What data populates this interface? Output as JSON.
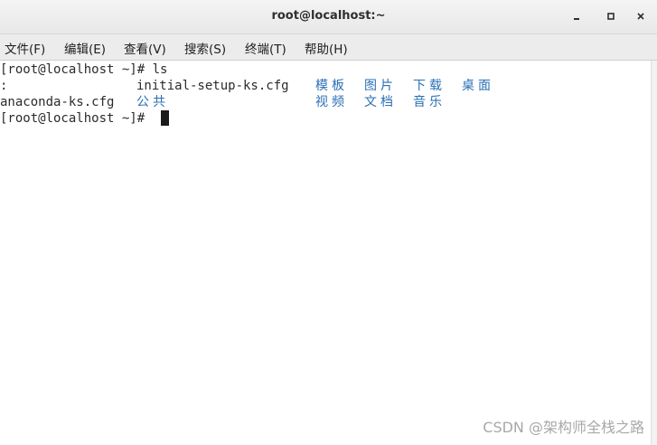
{
  "window": {
    "title": "root@localhost:~",
    "minimize_glyph": "▪",
    "maximize_glyph": "▫",
    "close_glyph": "✕"
  },
  "menu": [
    {
      "label": "文件(F)"
    },
    {
      "label": "编辑(E)"
    },
    {
      "label": "查看(V)"
    },
    {
      "label": "搜索(S)"
    },
    {
      "label": "终端(T)"
    },
    {
      "label": "帮助(H)"
    }
  ],
  "terminal": {
    "prompt": "[root@localhost ~]# ",
    "command": "ls",
    "left_fragment": ":",
    "files": {
      "initial_setup": "initial-setup-ks.cfg",
      "anaconda": "anaconda-ks.cfg"
    },
    "dirs": {
      "templates": "模板",
      "pictures": "图片",
      "downloads": "下载",
      "desktop": "桌面",
      "public": "公共",
      "videos": "视频",
      "documents": "文档",
      "music": "音乐"
    },
    "dir_color": "#2a6fb5"
  },
  "watermark": "CSDN @架构师全栈之路"
}
